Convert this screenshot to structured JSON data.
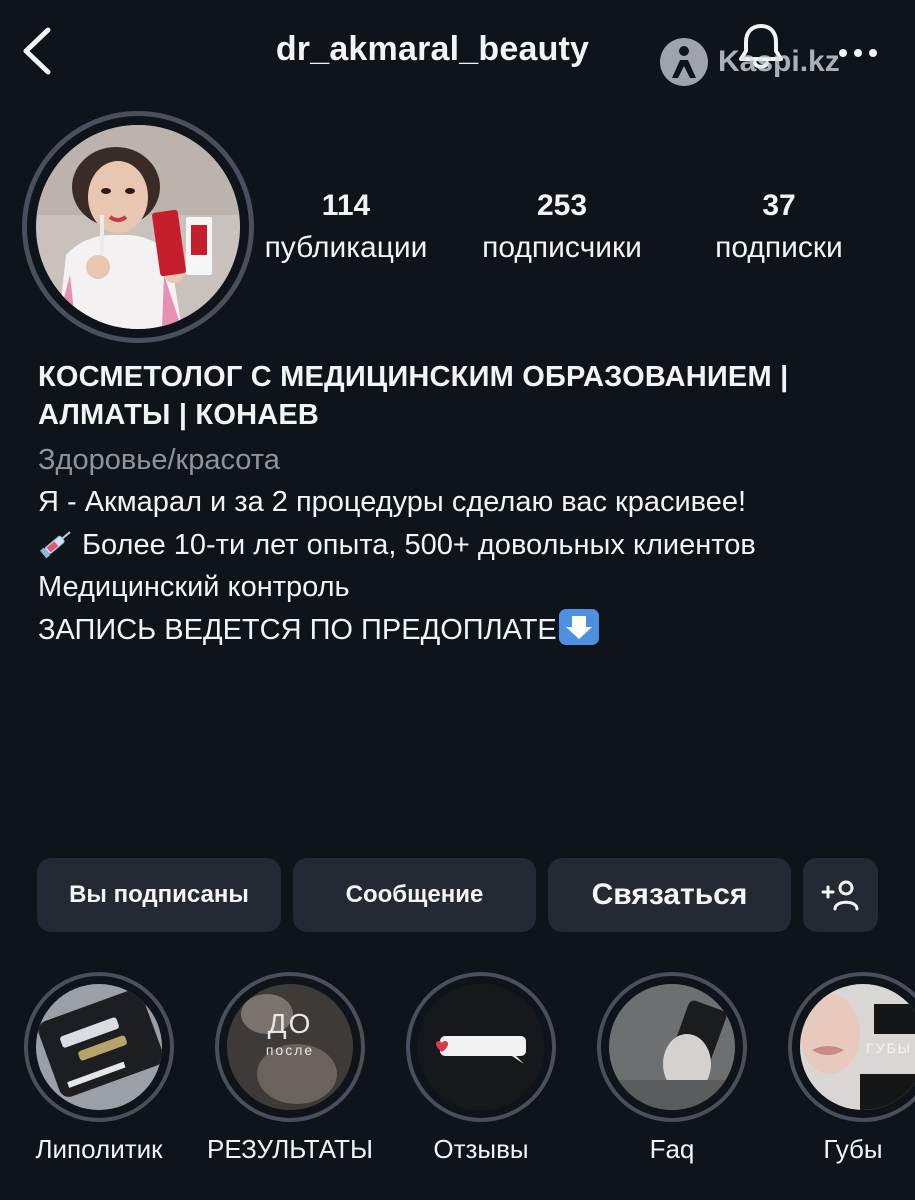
{
  "header": {
    "username": "dr_akmaral_beauty",
    "back_icon": "chevron-left-icon",
    "bell_icon": "bell-icon",
    "more_icon": "more-dots-icon",
    "watermark": "Kaspi.kz"
  },
  "profile": {
    "stats": [
      {
        "value": "114",
        "label": "публикации"
      },
      {
        "value": "253",
        "label": "подписчики"
      },
      {
        "value": "37",
        "label": "подписки"
      }
    ],
    "title": "КОСМЕТОЛОГ С МЕДИЦИНСКИМ ОБРАЗОВАНИЕМ | АЛМАТЫ | КОНАЕВ",
    "category": "Здоровье/красота",
    "bio": [
      "Я - Акмарал и за 2 процедуры сделаю вас красивее!",
      "Более 10-ти лет опыта, 500+ довольных клиентов",
      "Медицинский контроль",
      "ЗАПИСЬ ВЕДЕТСЯ ПО ПРЕДОПЛАТЕ"
    ]
  },
  "actions": {
    "following": "Вы подписаны",
    "message": "Сообщение",
    "contact": "Связаться",
    "add_icon": "add-person-icon"
  },
  "highlights": [
    {
      "label": "Липолитик"
    },
    {
      "label": "РЕЗУЛЬТАТЫ",
      "overlay_top": "ДО",
      "overlay_bottom": "после"
    },
    {
      "label": "Отзывы"
    },
    {
      "label": "Faq"
    },
    {
      "label": "Губы",
      "overlay_top": "ГУБЫ"
    }
  ],
  "colors": {
    "background": "#0f131a",
    "button": "#242a33",
    "ring": "#4a505b",
    "muted_text": "#8e939c"
  }
}
